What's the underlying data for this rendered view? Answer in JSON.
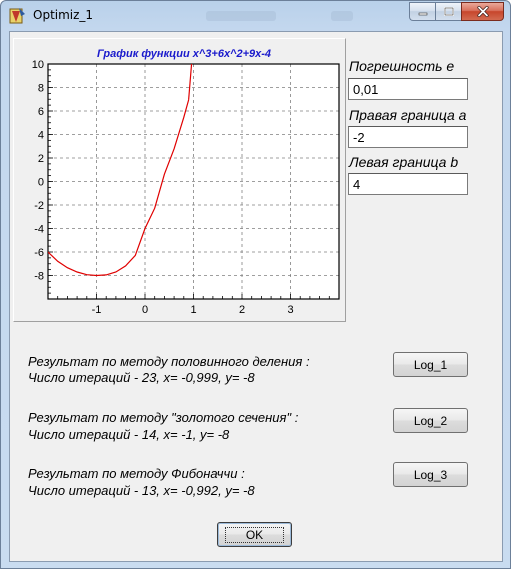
{
  "window": {
    "title": "Optimiz_1"
  },
  "inputs": {
    "epsilon_label": "Погрешность e",
    "epsilon_value": "0,01",
    "right_bound_label": "Правая граница a",
    "right_bound_value": "-2",
    "left_bound_label": "Левая граница b",
    "left_bound_value": "4"
  },
  "results": {
    "bisection_title": "Результат по методу половинного деления :",
    "bisection_detail": "Число итераций - 23, x= -0,999, y= -8",
    "golden_title": "Результат по методу \"золотого сечения\" :",
    "golden_detail": "Число итераций - 14, x= -1, y= -8",
    "fibonacci_title": "Результат по методу Фибоначчи :",
    "fibonacci_detail": "Число итераций - 13, x= -0,992, y= -8"
  },
  "buttons": {
    "log1": "Log_1",
    "log2": "Log_2",
    "log3": "Log_3",
    "ok": "OK"
  },
  "chart_data": {
    "type": "line",
    "title": "График функции x^3+6x^2+9x-4",
    "xlabel": "",
    "ylabel": "",
    "xlim": [
      -2,
      4
    ],
    "ylim": [
      -10,
      10
    ],
    "x_ticks": [
      -1,
      0,
      1,
      2,
      3
    ],
    "y_ticks": [
      10,
      8,
      6,
      4,
      2,
      0,
      -2,
      -4,
      -6,
      -8
    ],
    "grid": true,
    "series": [
      {
        "color": "#e00000",
        "x": [
          -2,
          -1.8,
          -1.6,
          -1.4,
          -1.2,
          -1,
          -0.8,
          -0.6,
          -0.4,
          -0.2,
          0,
          0.2,
          0.4,
          0.6,
          0.8,
          0.9
        ],
        "y": [
          -6,
          -6.79,
          -7.34,
          -7.7,
          -7.93,
          -8,
          -7.95,
          -7.7,
          -7.18,
          -6.29,
          -4,
          -2.27,
          0.62,
          2.78,
          5.46,
          6.97
        ]
      }
    ],
    "title_color": "#1a1acc"
  }
}
